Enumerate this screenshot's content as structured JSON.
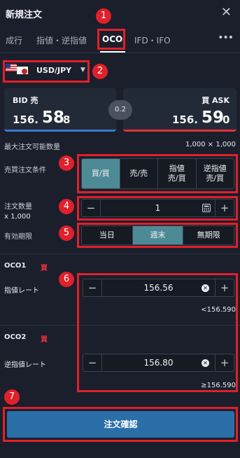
{
  "header": {
    "title": "新規注文",
    "close_icon": "close-icon"
  },
  "tabs": [
    {
      "label": "成行"
    },
    {
      "label": "指値・逆指値"
    },
    {
      "label": "OCO"
    },
    {
      "label": "IFD・IFO"
    }
  ],
  "tabs_more": "•••",
  "pair": {
    "label": "USD/JPY",
    "caret": "▼",
    "flags": [
      "us-flag",
      "jp-flag"
    ]
  },
  "quote": {
    "bid": {
      "label": "BID 売",
      "small": "156.",
      "big": "58",
      "pip": "8"
    },
    "ask": {
      "label": "買 ASK",
      "small": "156.",
      "big": "59",
      "pip": "0"
    },
    "spread": "0.2"
  },
  "max_order": {
    "label": "最大注文可能数量",
    "value": "1,000 × 1,000"
  },
  "buy_sell_condition": {
    "label": "売買注文条件",
    "options": [
      "買/買",
      "売/売",
      "指値\n売/買",
      "逆指値\n売/買"
    ],
    "selected": 0
  },
  "quantity": {
    "label": "注文数量",
    "unit": "x 1,000",
    "value": "1",
    "minus": "−",
    "plus": "+"
  },
  "validity": {
    "label": "有効期限",
    "options": [
      "当日",
      "週末",
      "無期限"
    ],
    "selected": 1
  },
  "oco1": {
    "title": "OCO1",
    "side": "買",
    "rate_label": "指値レート",
    "value": "156.56",
    "condition": "<156.590"
  },
  "oco2": {
    "title": "OCO2",
    "side": "買",
    "rate_label": "逆指値レート",
    "value": "156.80",
    "condition": "≥156.590"
  },
  "confirm_button": "注文確認",
  "callouts": [
    "1",
    "2",
    "3",
    "4",
    "5",
    "6",
    "7"
  ],
  "colors": {
    "accent_red": "#e0202a",
    "bid_blue": "#3a7bd5",
    "ask_red": "#e0313b",
    "selected_teal": "#4d8a95",
    "confirm_blue": "#2a6fa8"
  }
}
